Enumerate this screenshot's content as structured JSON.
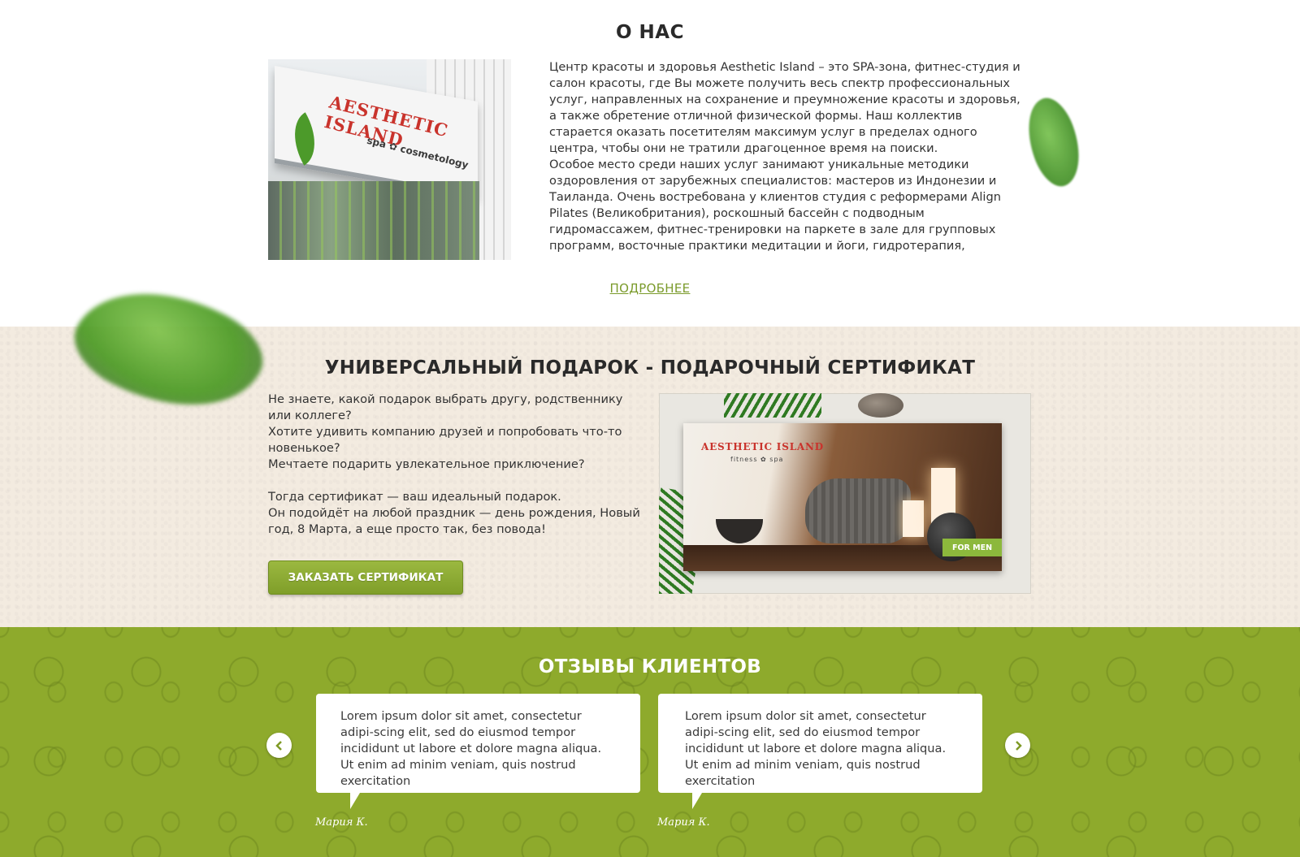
{
  "about": {
    "title": "О НАС",
    "text_p1": "Центр красоты и здоровья Aesthetic Island – это SPA-зона, фитнес-студия и салон красоты, где Вы можете получить весь спектр профессиональных услуг, направленных на сохранение и преумножение красоты и здоровья, а также обретение отличной физической формы. Наш коллектив старается оказать посетителям максимум услуг в пределах одного центра, чтобы они не тратили драгоценное время на поиски.",
    "text_p2": "Особое место среди наших услуг занимают уникальные методики оздоровления от зарубежных специалистов: мастеров из Индонезии и Таиланда. Очень востребована у клиентов студия с реформерами Align Pilates (Великобритания), роскошный бассейн с подводным гидромассажем, фитнес-тренировки на паркете в зале для групповых программ, восточные практики медитации и йоги, гидротерапия, комплексные SPA-программы,",
    "more_link": "ПОДРОБНЕЕ",
    "photo": {
      "sign": "AESTHETIC ISLAND",
      "sign_sub": "spa ✿ cosmetology"
    }
  },
  "gift": {
    "title": "УНИВЕРСАЛЬНЫЙ ПОДАРОК - ПОДАРОЧНЫЙ СЕРТИФИКАТ",
    "line1": "Не знаете, какой подарок выбрать другу, родственнику или коллеге?",
    "line2": "Хотите удивить компанию друзей и попробовать что-то новенькое?",
    "line3": "Мечтаете подарить увлекательное приключение?",
    "line4": "Тогда сертификат — ваш идеальный подарок.",
    "line5": "Он подойдёт на любой праздник — день рождения, Новый год, 8 Марта, а еще просто так, без повода!",
    "button": "ЗАКАЗАТЬ СЕРТИФИКАТ",
    "certificate": {
      "brand": "AESTHETIC ISLAND",
      "brand_sub": "fitness ✿ spa",
      "tag": "FOR MEN"
    }
  },
  "reviews": {
    "title": "ОТЗЫВЫ КЛИЕНТОВ",
    "prev_icon": "chevron-left-icon",
    "next_icon": "chevron-right-icon",
    "items": [
      {
        "text": "Lorem ipsum dolor sit amet, consectetur adipi-scing elit, sed do eiusmod tempor incididunt ut labore et dolore magna aliqua. Ut enim ad minim veniam, quis nostrud exercitation",
        "author": "Мария К."
      },
      {
        "text": "Lorem ipsum dolor sit amet, consectetur adipi-scing elit, sed do eiusmod tempor incididunt ut labore et dolore magna aliqua. Ut enim ad minim veniam, quis nostrud exercitation",
        "author": "Мария К."
      }
    ]
  },
  "colors": {
    "accent_green": "#8eaa2c",
    "link_green": "#7b9b2c",
    "beige": "#f3ebe0"
  }
}
